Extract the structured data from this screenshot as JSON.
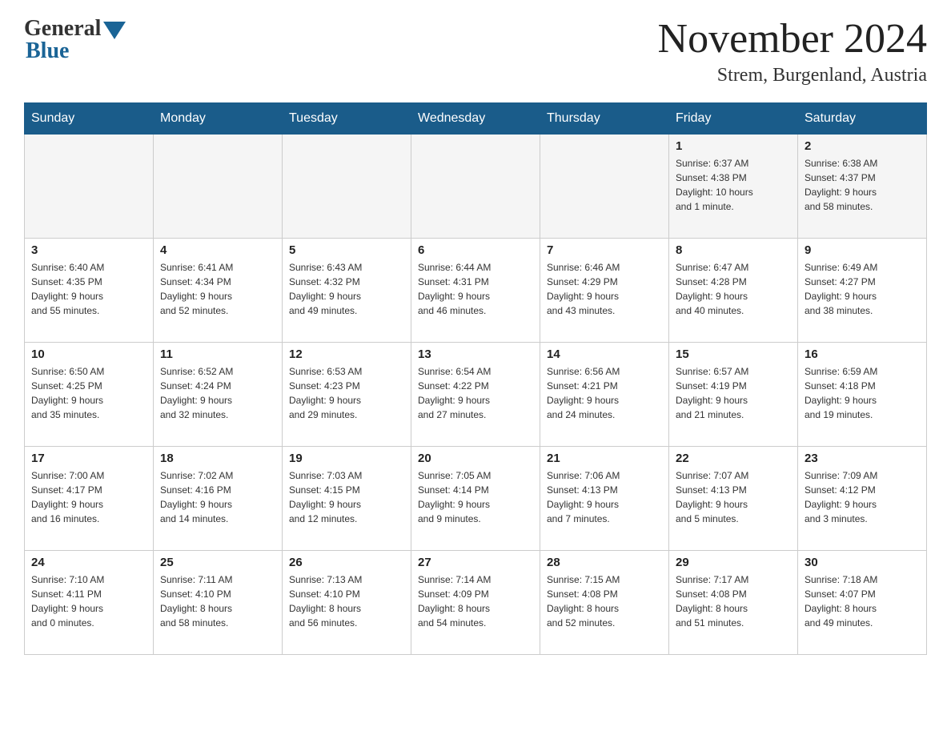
{
  "header": {
    "logo_general": "General",
    "logo_blue": "Blue",
    "month_title": "November 2024",
    "location": "Strem, Burgenland, Austria"
  },
  "days_of_week": [
    "Sunday",
    "Monday",
    "Tuesday",
    "Wednesday",
    "Thursday",
    "Friday",
    "Saturday"
  ],
  "weeks": [
    {
      "days": [
        {
          "number": "",
          "info": ""
        },
        {
          "number": "",
          "info": ""
        },
        {
          "number": "",
          "info": ""
        },
        {
          "number": "",
          "info": ""
        },
        {
          "number": "",
          "info": ""
        },
        {
          "number": "1",
          "info": "Sunrise: 6:37 AM\nSunset: 4:38 PM\nDaylight: 10 hours\nand 1 minute."
        },
        {
          "number": "2",
          "info": "Sunrise: 6:38 AM\nSunset: 4:37 PM\nDaylight: 9 hours\nand 58 minutes."
        }
      ]
    },
    {
      "days": [
        {
          "number": "3",
          "info": "Sunrise: 6:40 AM\nSunset: 4:35 PM\nDaylight: 9 hours\nand 55 minutes."
        },
        {
          "number": "4",
          "info": "Sunrise: 6:41 AM\nSunset: 4:34 PM\nDaylight: 9 hours\nand 52 minutes."
        },
        {
          "number": "5",
          "info": "Sunrise: 6:43 AM\nSunset: 4:32 PM\nDaylight: 9 hours\nand 49 minutes."
        },
        {
          "number": "6",
          "info": "Sunrise: 6:44 AM\nSunset: 4:31 PM\nDaylight: 9 hours\nand 46 minutes."
        },
        {
          "number": "7",
          "info": "Sunrise: 6:46 AM\nSunset: 4:29 PM\nDaylight: 9 hours\nand 43 minutes."
        },
        {
          "number": "8",
          "info": "Sunrise: 6:47 AM\nSunset: 4:28 PM\nDaylight: 9 hours\nand 40 minutes."
        },
        {
          "number": "9",
          "info": "Sunrise: 6:49 AM\nSunset: 4:27 PM\nDaylight: 9 hours\nand 38 minutes."
        }
      ]
    },
    {
      "days": [
        {
          "number": "10",
          "info": "Sunrise: 6:50 AM\nSunset: 4:25 PM\nDaylight: 9 hours\nand 35 minutes."
        },
        {
          "number": "11",
          "info": "Sunrise: 6:52 AM\nSunset: 4:24 PM\nDaylight: 9 hours\nand 32 minutes."
        },
        {
          "number": "12",
          "info": "Sunrise: 6:53 AM\nSunset: 4:23 PM\nDaylight: 9 hours\nand 29 minutes."
        },
        {
          "number": "13",
          "info": "Sunrise: 6:54 AM\nSunset: 4:22 PM\nDaylight: 9 hours\nand 27 minutes."
        },
        {
          "number": "14",
          "info": "Sunrise: 6:56 AM\nSunset: 4:21 PM\nDaylight: 9 hours\nand 24 minutes."
        },
        {
          "number": "15",
          "info": "Sunrise: 6:57 AM\nSunset: 4:19 PM\nDaylight: 9 hours\nand 21 minutes."
        },
        {
          "number": "16",
          "info": "Sunrise: 6:59 AM\nSunset: 4:18 PM\nDaylight: 9 hours\nand 19 minutes."
        }
      ]
    },
    {
      "days": [
        {
          "number": "17",
          "info": "Sunrise: 7:00 AM\nSunset: 4:17 PM\nDaylight: 9 hours\nand 16 minutes."
        },
        {
          "number": "18",
          "info": "Sunrise: 7:02 AM\nSunset: 4:16 PM\nDaylight: 9 hours\nand 14 minutes."
        },
        {
          "number": "19",
          "info": "Sunrise: 7:03 AM\nSunset: 4:15 PM\nDaylight: 9 hours\nand 12 minutes."
        },
        {
          "number": "20",
          "info": "Sunrise: 7:05 AM\nSunset: 4:14 PM\nDaylight: 9 hours\nand 9 minutes."
        },
        {
          "number": "21",
          "info": "Sunrise: 7:06 AM\nSunset: 4:13 PM\nDaylight: 9 hours\nand 7 minutes."
        },
        {
          "number": "22",
          "info": "Sunrise: 7:07 AM\nSunset: 4:13 PM\nDaylight: 9 hours\nand 5 minutes."
        },
        {
          "number": "23",
          "info": "Sunrise: 7:09 AM\nSunset: 4:12 PM\nDaylight: 9 hours\nand 3 minutes."
        }
      ]
    },
    {
      "days": [
        {
          "number": "24",
          "info": "Sunrise: 7:10 AM\nSunset: 4:11 PM\nDaylight: 9 hours\nand 0 minutes."
        },
        {
          "number": "25",
          "info": "Sunrise: 7:11 AM\nSunset: 4:10 PM\nDaylight: 8 hours\nand 58 minutes."
        },
        {
          "number": "26",
          "info": "Sunrise: 7:13 AM\nSunset: 4:10 PM\nDaylight: 8 hours\nand 56 minutes."
        },
        {
          "number": "27",
          "info": "Sunrise: 7:14 AM\nSunset: 4:09 PM\nDaylight: 8 hours\nand 54 minutes."
        },
        {
          "number": "28",
          "info": "Sunrise: 7:15 AM\nSunset: 4:08 PM\nDaylight: 8 hours\nand 52 minutes."
        },
        {
          "number": "29",
          "info": "Sunrise: 7:17 AM\nSunset: 4:08 PM\nDaylight: 8 hours\nand 51 minutes."
        },
        {
          "number": "30",
          "info": "Sunrise: 7:18 AM\nSunset: 4:07 PM\nDaylight: 8 hours\nand 49 minutes."
        }
      ]
    }
  ]
}
